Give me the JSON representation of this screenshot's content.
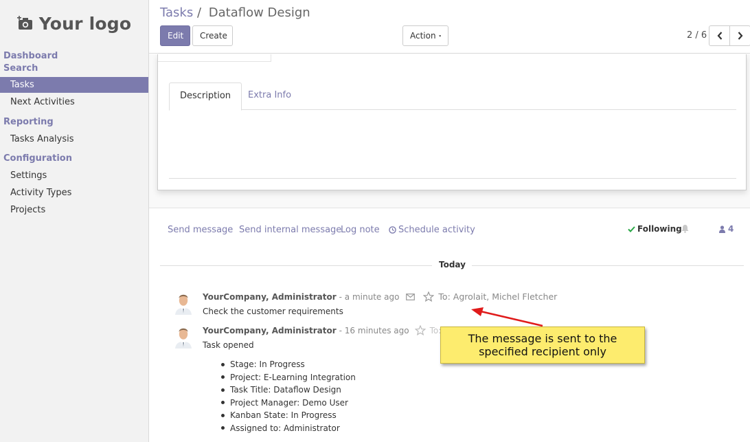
{
  "brand": {
    "logo_text": "Your logo"
  },
  "sidebar": {
    "sections": [
      {
        "label": "Dashboard"
      },
      {
        "label": "Search"
      }
    ],
    "items_search": [
      {
        "label": "Tasks",
        "active": true
      },
      {
        "label": "Next Activities",
        "active": false
      }
    ],
    "reporting": {
      "label": "Reporting",
      "items": [
        {
          "label": "Tasks Analysis"
        }
      ]
    },
    "configuration": {
      "label": "Configuration",
      "items": [
        {
          "label": "Settings"
        },
        {
          "label": "Activity Types"
        },
        {
          "label": "Projects"
        }
      ]
    }
  },
  "header": {
    "breadcrumb_parent": "Tasks",
    "breadcrumb_sep": "/",
    "breadcrumb_current": "Dataflow Design",
    "edit_label": "Edit",
    "create_label": "Create",
    "action_label": "Action",
    "pager": "2 / 6"
  },
  "form": {
    "tabs": [
      {
        "label": "Description",
        "active": true
      },
      {
        "label": "Extra Info",
        "active": false
      }
    ]
  },
  "chatter": {
    "actions": {
      "send_message": "Send message",
      "send_internal": "Send internal message",
      "log_note": "Log note",
      "schedule_activity": "Schedule activity"
    },
    "following_label": "Following",
    "followers_count": "4",
    "day_label": "Today",
    "messages": [
      {
        "author": "YourCompany, Administrator",
        "time": "- a minute ago",
        "recipients": "To: Agrolait, Michel Fletcher",
        "body": "Check the customer requirements"
      },
      {
        "author": "YourCompany, Administrator",
        "time": "- 16 minutes ago",
        "recipients": "To: Yo",
        "body": "Task opened",
        "tracking": [
          "Stage: In Progress",
          "Project: E-Learning Integration",
          "Task Title: Dataflow Design",
          "Project Manager: Demo User",
          "Kanban State: In Progress",
          "Assigned to: Administrator"
        ]
      }
    ]
  },
  "annotation": {
    "line1": "The message is sent to the",
    "line2": "specified recipient only"
  },
  "colors": {
    "accent": "#7c7bad",
    "following_check": "#28a745",
    "callout": "#fdec6e",
    "arrow": "#e01b1b"
  }
}
